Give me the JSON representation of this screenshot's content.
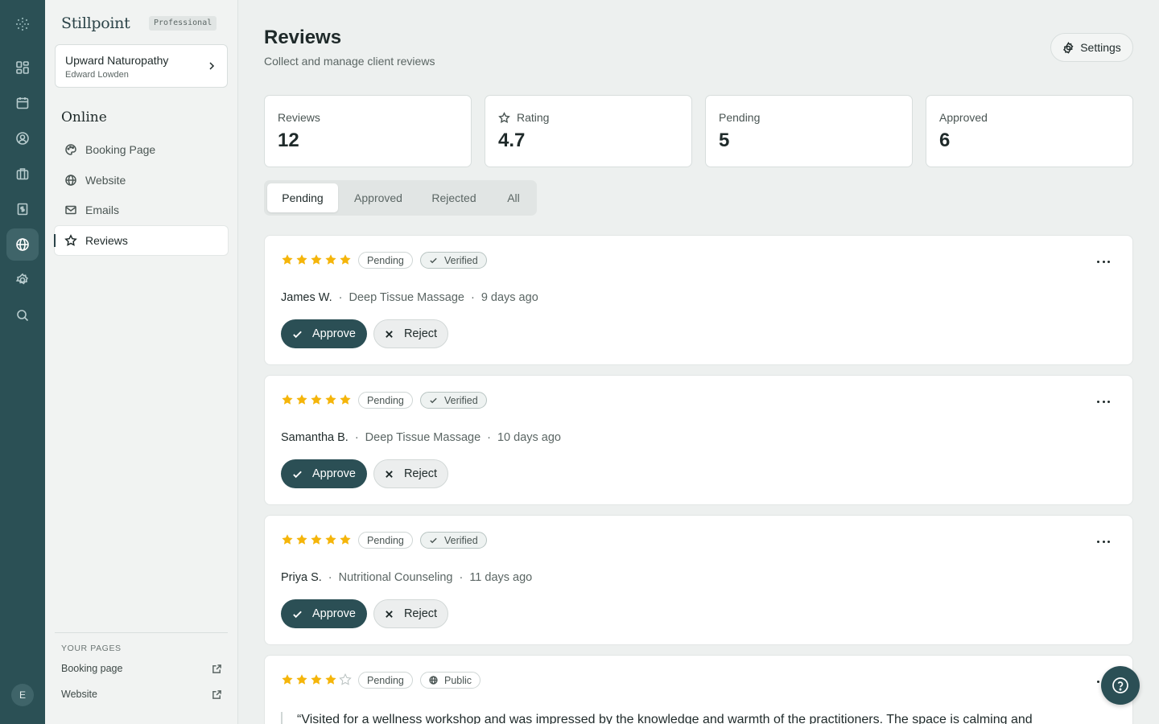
{
  "colors": {
    "rail": "#2b5055",
    "primary": "#2b4f55",
    "star": "#f5b50a",
    "background": "#edf0ef"
  },
  "rail": {
    "icons": [
      "apps-icon",
      "dashboard-icon",
      "calendar-icon",
      "user-circle-icon",
      "briefcase-icon",
      "invoice-icon",
      "globe-icon",
      "gear-icon",
      "search-icon"
    ],
    "active": "globe-icon",
    "avatar_initial": "E"
  },
  "sidebar": {
    "brand": "Stillpoint",
    "plan": "Professional",
    "org": {
      "name": "Upward Naturopathy",
      "owner": "Edward Lowden"
    },
    "section_title": "Online",
    "items": [
      {
        "label": "Booking Page",
        "icon": "palette-icon"
      },
      {
        "label": "Website",
        "icon": "globe-icon"
      },
      {
        "label": "Emails",
        "icon": "mail-icon"
      },
      {
        "label": "Reviews",
        "icon": "star-icon",
        "active": true
      }
    ],
    "pages_label": "YOUR PAGES",
    "pages": [
      {
        "label": "Booking page",
        "icon": "external-link-icon"
      },
      {
        "label": "Website",
        "icon": "external-link-icon"
      }
    ]
  },
  "header": {
    "title": "Reviews",
    "subtitle": "Collect and manage client reviews",
    "settings_label": "Settings"
  },
  "stats": [
    {
      "label": "Reviews",
      "value": "12"
    },
    {
      "label": "Rating",
      "value": "4.7",
      "icon": "star-icon"
    },
    {
      "label": "Pending",
      "value": "5"
    },
    {
      "label": "Approved",
      "value": "6"
    }
  ],
  "tabs": [
    {
      "label": "Pending",
      "active": true
    },
    {
      "label": "Approved"
    },
    {
      "label": "Rejected"
    },
    {
      "label": "All"
    }
  ],
  "reviews": [
    {
      "rating": 5,
      "status": "Pending",
      "visibility": "Verified",
      "name": "James W.",
      "service": "Deep Tissue Massage",
      "time": "9 days ago"
    },
    {
      "rating": 5,
      "status": "Pending",
      "visibility": "Verified",
      "name": "Samantha B.",
      "service": "Deep Tissue Massage",
      "time": "10 days ago"
    },
    {
      "rating": 5,
      "status": "Pending",
      "visibility": "Verified",
      "name": "Priya S.",
      "service": "Nutritional Counseling",
      "time": "11 days ago"
    },
    {
      "rating": 4,
      "status": "Pending",
      "visibility": "Public",
      "quote": "“Visited for a wellness workshop and was impressed by the knowledge and warmth of the practitioners. The space is calming and"
    }
  ],
  "actions": {
    "approve": "Approve",
    "reject": "Reject"
  },
  "separator": "·"
}
